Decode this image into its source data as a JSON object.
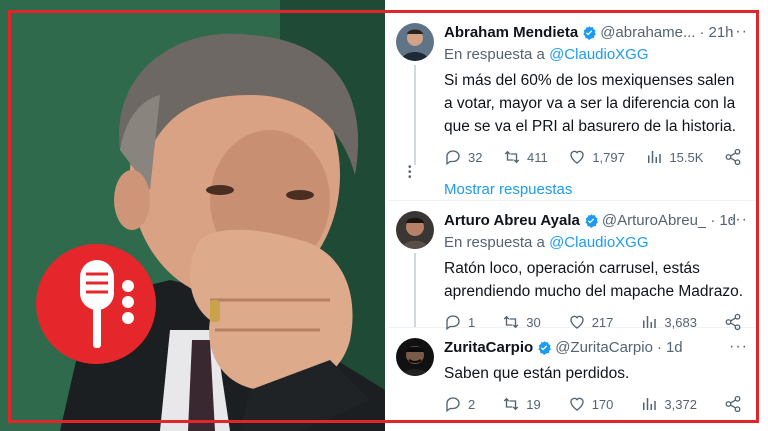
{
  "tweets": [
    {
      "name": "Abraham Mendieta",
      "handle": "@abrahame...",
      "time": "21h",
      "reply_prefix": "En respuesta a",
      "reply_to": "@ClaudioXGG",
      "text": "Si más del 60% de los mexiquenses salen a votar, mayor va a ser la diferencia con la que se va el PRI al basurero de la historia.",
      "replies": "32",
      "retweets": "411",
      "likes": "1,797",
      "views": "15.5K"
    },
    {
      "name": "Arturo Abreu Ayala",
      "handle": "@ArturoAbreu_",
      "time": "1d",
      "reply_prefix": "En respuesta a",
      "reply_to": "@ClaudioXGG",
      "text": "Ratón loco, operación carrusel, estás aprendiendo mucho del mapache Madrazo.",
      "replies": "1",
      "retweets": "30",
      "likes": "217",
      "views": "3,683"
    },
    {
      "name": "ZuritaCarpio",
      "handle": "@ZuritaCarpio",
      "time": "1d",
      "text": "Saben que están perdidos.",
      "replies": "2",
      "retweets": "19",
      "likes": "170",
      "views": "3,372"
    }
  ],
  "show_replies": "Mostrar respuestas",
  "icons": [
    "verified-badge-icon",
    "reply-icon",
    "retweet-icon",
    "like-icon",
    "views-icon",
    "share-icon",
    "more-icon",
    "microphone-icon"
  ],
  "colors": {
    "accent": "#1d9bf0",
    "frame": "#e0262a",
    "logo_bg": "#e5262b"
  }
}
